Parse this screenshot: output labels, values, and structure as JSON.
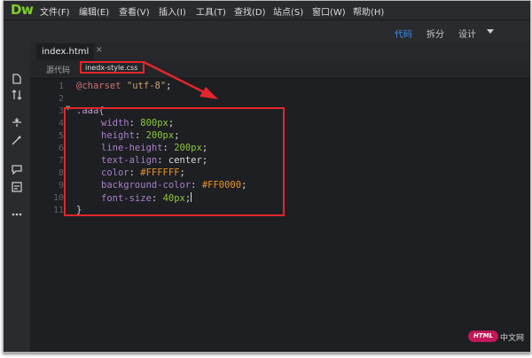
{
  "app": {
    "logo": "Dw"
  },
  "menu": [
    "文件(F)",
    "编辑(E)",
    "查看(V)",
    "插入(I)",
    "工具(T)",
    "查找(D)",
    "站点(S)",
    "窗口(W)",
    "帮助(H)"
  ],
  "views": {
    "code": "代码",
    "split": "拆分",
    "design": "设计"
  },
  "document": {
    "tab": "index.html"
  },
  "related_files": {
    "source": "源代码",
    "css": "inedx-style.css"
  },
  "code": {
    "line_numbers": [
      "1",
      "2",
      "3",
      "4",
      "5",
      "6",
      "7",
      "8",
      "9",
      "10",
      "11"
    ],
    "charset": {
      "at": "@charset",
      "value": "\"utf-8\"",
      "end": ";"
    },
    "selector": ".aaa{",
    "declarations": [
      {
        "prop": "width",
        "value": "800px",
        "kind": "num"
      },
      {
        "prop": "height",
        "value": "200px",
        "kind": "num"
      },
      {
        "prop": "line-height",
        "value": "200px",
        "kind": "num"
      },
      {
        "prop": "text-align",
        "value": "center",
        "kind": "kw"
      },
      {
        "prop": "color",
        "value": "#FFFFFF",
        "kind": "hex"
      },
      {
        "prop": "background-color",
        "value": "#FF0000",
        "kind": "hex"
      },
      {
        "prop": "font-size",
        "value": "40px",
        "kind": "num"
      }
    ],
    "closing": "}"
  },
  "watermark": {
    "badge": "HTML",
    "text": "中文网"
  },
  "colors": {
    "annotation": "#e3262b",
    "active_view": "#3b8eea",
    "logo": "#7fcf2b"
  }
}
